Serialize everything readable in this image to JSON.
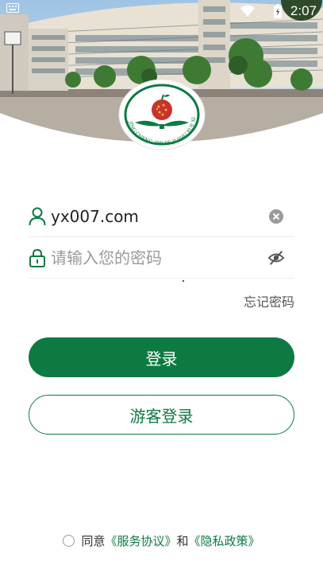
{
  "status_bar": {
    "time": "2:07"
  },
  "login": {
    "username": {
      "value": "yx007.com",
      "placeholder": ""
    },
    "password": {
      "value": "",
      "placeholder": "请输入您的密码"
    },
    "forgot_label": "忘记密码",
    "login_label": "登录",
    "guest_label": "游客登录"
  },
  "agreement": {
    "prefix": "同意",
    "service_link": "《服务协议》",
    "conjunction": "和",
    "privacy_link": "《隐私政策》"
  },
  "logo": {
    "ring_text": "JING CHENG ZHI YE JI SHU XUE XIAO"
  },
  "colors": {
    "brand_green": "#0e7a43",
    "logo_red": "#c8332b"
  }
}
